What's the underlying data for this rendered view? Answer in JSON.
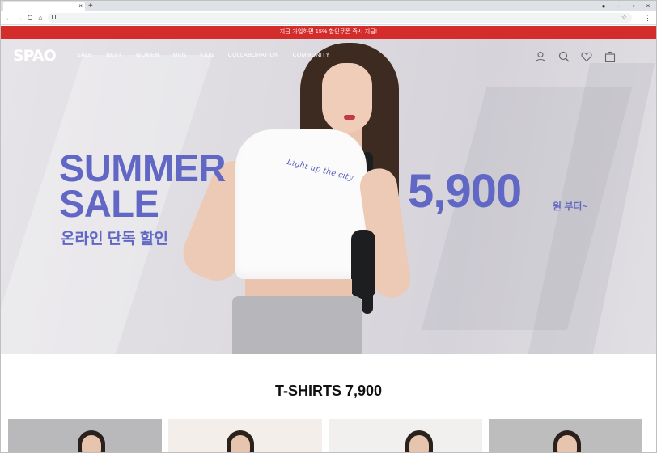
{
  "browser": {
    "tab_close": "×",
    "new_tab": "+",
    "back": "←",
    "forward": "→",
    "reload": "C",
    "home": "⌂",
    "bookmark": "☆",
    "menu": "⋮",
    "window": {
      "minimize": "–",
      "maximize": "▫",
      "close": "×",
      "profile": "●"
    }
  },
  "promo": {
    "text": "지금 가입하면 15% 할인쿠폰 즉시 지급!"
  },
  "site": {
    "logo": "SPAO",
    "nav": [
      "SALE",
      "BEST",
      "WOMEN",
      "MEN",
      "KIDS",
      "COLLABORATION",
      "COMMUNITY"
    ],
    "icons": [
      "user-icon",
      "search-icon",
      "heart-icon",
      "bag-icon"
    ]
  },
  "hero": {
    "title_line1": "SUMMER",
    "title_line2": "SALE",
    "subtitle": "온라인 단독 할인",
    "price": "5,900",
    "price_suffix": "원 부터~",
    "tee_print": "Light up the city",
    "slides_total": 4,
    "slide_active": 1
  },
  "section": {
    "title": "T-SHIRTS 7,900",
    "cards": [
      {
        "background": "#b9b9bb"
      },
      {
        "background": "#f3eeea"
      },
      {
        "background": "#f2f0ee"
      },
      {
        "background": "#bdbdbe"
      }
    ]
  },
  "colors": {
    "accent": "#6167c4",
    "promo": "#d42b2b"
  }
}
